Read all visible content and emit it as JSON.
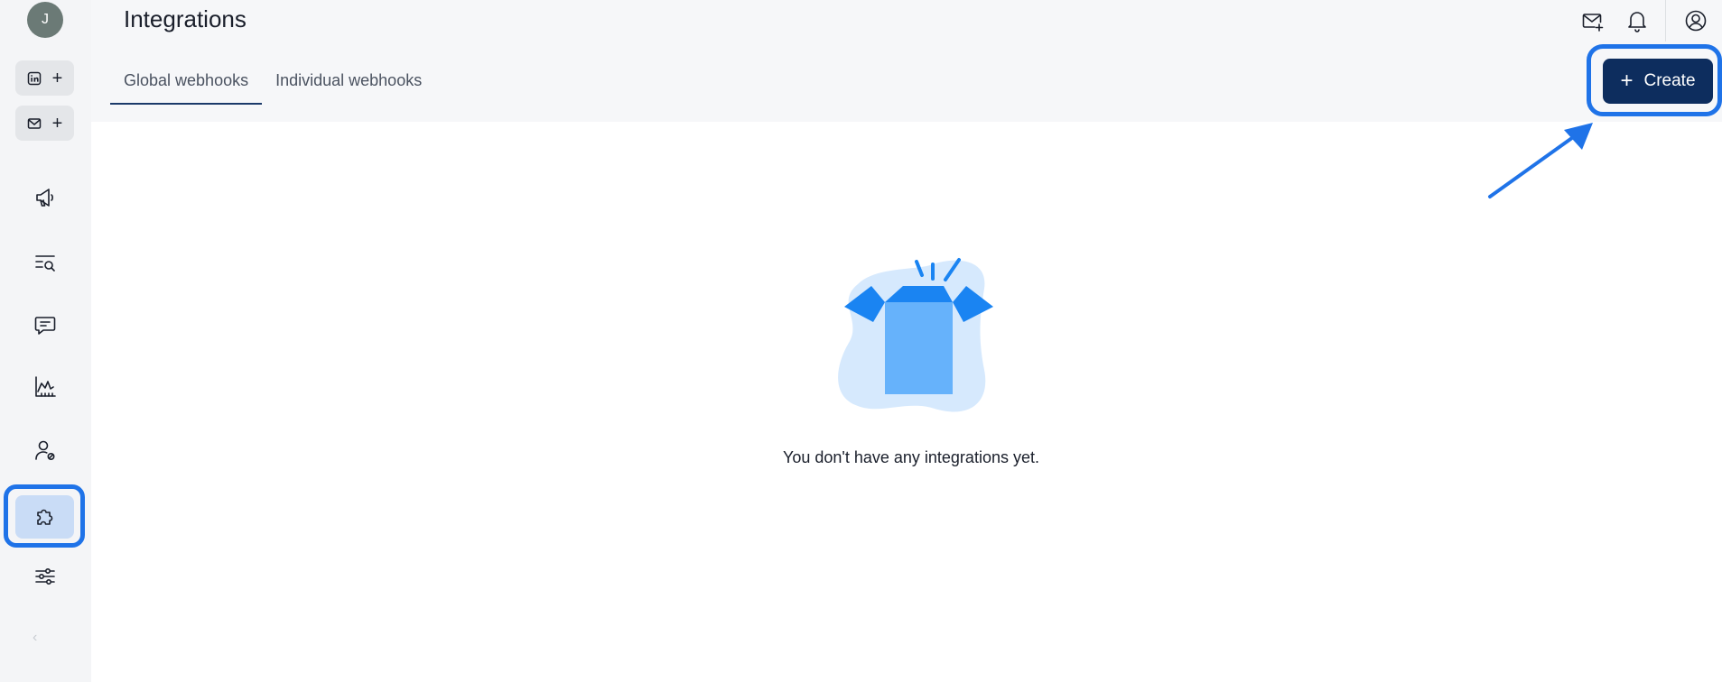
{
  "sidebar": {
    "avatar_initial": "J",
    "account_buttons": [
      {
        "icon": "linkedin-icon",
        "action": "add-linkedin"
      },
      {
        "icon": "mail-icon",
        "action": "add-email"
      }
    ],
    "items": [
      {
        "name": "campaigns",
        "icon": "megaphone-icon"
      },
      {
        "name": "search",
        "icon": "list-search-icon"
      },
      {
        "name": "messages",
        "icon": "chat-icon"
      },
      {
        "name": "analytics",
        "icon": "chart-icon"
      },
      {
        "name": "accounts",
        "icon": "user-settings-icon"
      },
      {
        "name": "integrations",
        "icon": "puzzle-icon",
        "active": true
      },
      {
        "name": "settings",
        "icon": "sliders-icon"
      }
    ],
    "collapse_glyph": "‹"
  },
  "header": {
    "title": "Integrations",
    "tabs": [
      {
        "label": "Global webhooks",
        "active": true
      },
      {
        "label": "Individual webhooks",
        "active": false
      }
    ],
    "create_label": "Create"
  },
  "empty_state": {
    "message": "You don't have any integrations yet."
  },
  "colors": {
    "accent": "#1f73e8",
    "primary_button": "#0d2d5e",
    "active_nav_bg": "#c9dcf6",
    "box_dark": "#1a84f2",
    "box_light": "#66b2fb",
    "blob": "#d6e9fd"
  }
}
